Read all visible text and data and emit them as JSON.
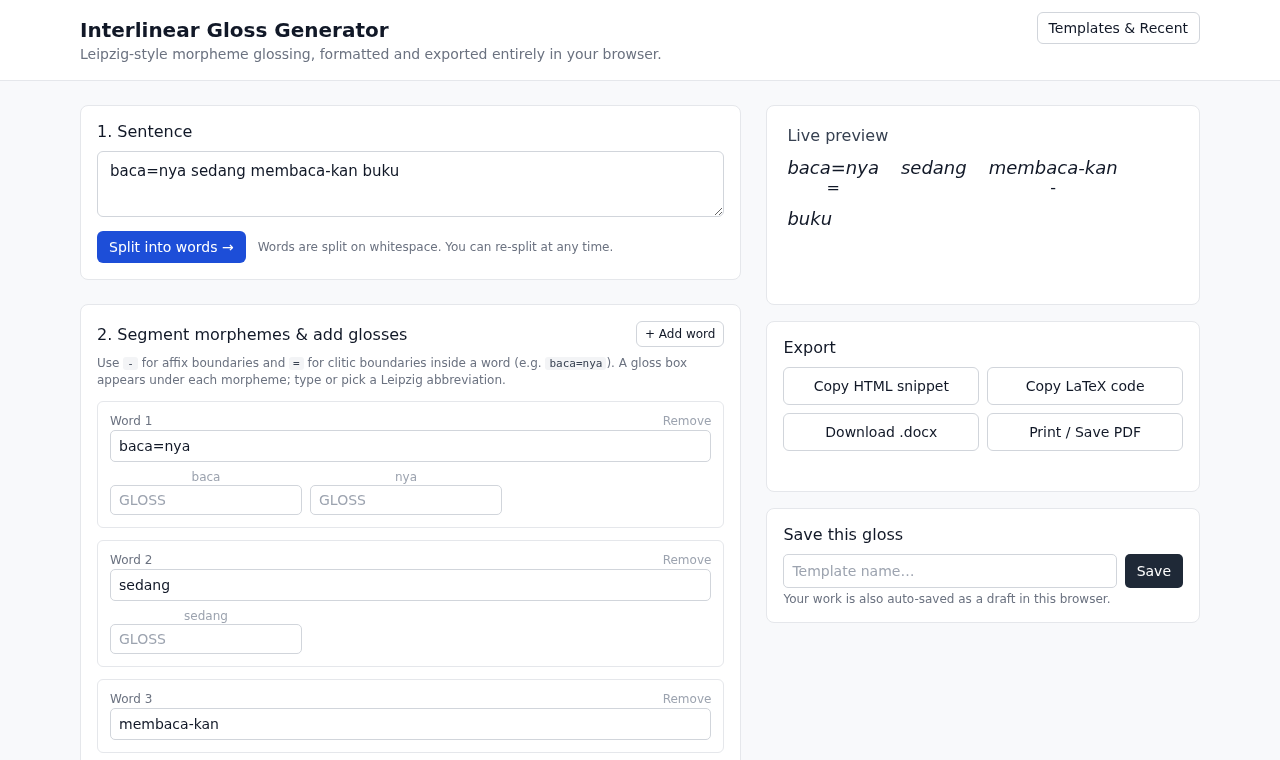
{
  "header": {
    "title": "Interlinear Gloss Generator",
    "subtitle": "Leipzig-style morpheme glossing, formatted and exported entirely in your browser.",
    "button": "Templates & Recent"
  },
  "sentence": {
    "heading": "1. Sentence",
    "value": "baca=nya sedang membaca-kan buku",
    "button": "Split into words →",
    "hint": "Words are split on whitespace. You can re-split at any time."
  },
  "segment": {
    "heading": "2. Segment morphemes & add glosses",
    "add_button": "+ Add word",
    "description": [
      {
        "kind": "text",
        "text": "Use "
      },
      {
        "kind": "code",
        "text": "-"
      },
      {
        "kind": "text",
        "text": " for affix boundaries and "
      },
      {
        "kind": "code",
        "text": "="
      },
      {
        "kind": "text",
        "text": " for clitic boundaries inside a word (e.g. "
      },
      {
        "kind": "code",
        "text": "baca=nya"
      },
      {
        "kind": "text",
        "text": "). A gloss box appears under each morpheme; type or pick a Leipzig abbreviation."
      }
    ],
    "words": [
      {
        "label": "Word 1",
        "remove": "Remove",
        "value": "baca=nya",
        "morphemes": [
          {
            "morpheme": "baca",
            "placeholder": "GLOSS"
          },
          {
            "morpheme": "nya",
            "placeholder": "GLOSS"
          }
        ]
      },
      {
        "label": "Word 2",
        "remove": "Remove",
        "value": "sedang",
        "morphemes": [
          {
            "morpheme": "sedang",
            "placeholder": "GLOSS"
          }
        ]
      },
      {
        "label": "Word 3",
        "remove": "Remove",
        "value": "membaca-kan"
      }
    ]
  },
  "preview": {
    "heading": "Live preview",
    "words": [
      {
        "word": "baca=nya",
        "mark": "="
      },
      {
        "word": "sedang"
      },
      {
        "word": "membaca-kan",
        "mark": "-"
      },
      {
        "word": "buku"
      }
    ]
  },
  "export": {
    "heading": "Export",
    "buttons": [
      "Copy HTML snippet",
      "Copy LaTeX code",
      "Download .docx",
      "Print / Save PDF"
    ]
  },
  "save": {
    "heading": "Save this gloss",
    "placeholder": "Template name…",
    "button": "Save",
    "note": "Your work is also auto-saved as a draft in this browser."
  }
}
